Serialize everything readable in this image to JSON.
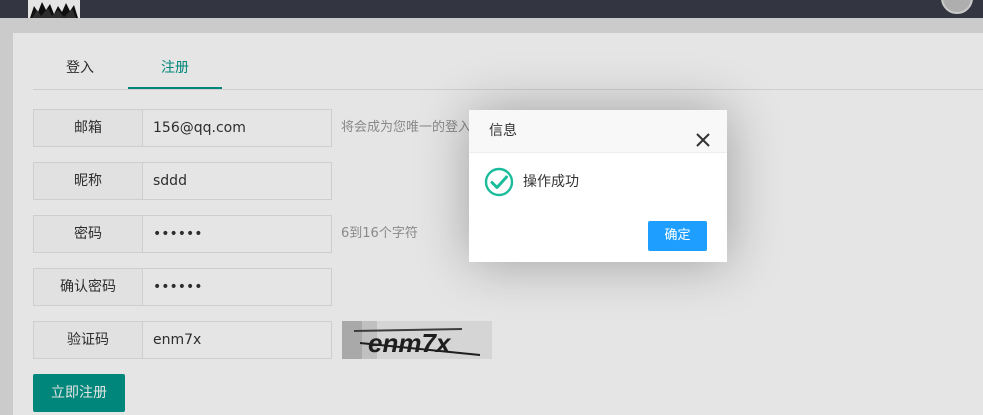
{
  "tabs": [
    {
      "label": "登入",
      "active": false
    },
    {
      "label": "注册",
      "active": true
    }
  ],
  "form": {
    "email": {
      "label": "邮箱",
      "value": "156@qq.com",
      "hint": "将会成为您唯一的登入名"
    },
    "nickname": {
      "label": "昵称",
      "value": "sddd"
    },
    "password": {
      "label": "密码",
      "value": "••••••",
      "hint": "6到16个字符"
    },
    "confirm": {
      "label": "确认密码",
      "value": "••••••"
    },
    "captcha": {
      "label": "验证码",
      "value": "enm7x",
      "image_text": "enm7x"
    },
    "submit_label": "立即注册"
  },
  "dialog": {
    "title": "信息",
    "message": "操作成功",
    "confirm_label": "确定",
    "icon": "check-circle-icon",
    "icon_color": "#5fb878"
  },
  "colors": {
    "accent": "#009688",
    "topbar": "#393d49",
    "dialog_button": "#1e9fff"
  }
}
